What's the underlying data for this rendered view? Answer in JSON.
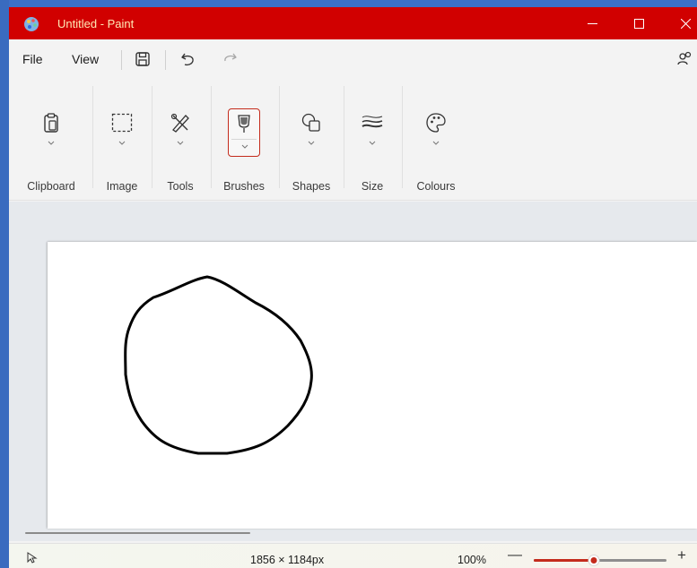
{
  "window": {
    "title": "Untitled - Paint",
    "accent_color": "#d10000"
  },
  "menubar": {
    "file_label": "File",
    "view_label": "View",
    "icons": [
      "save-icon",
      "undo-icon",
      "redo-icon",
      "account-icon"
    ]
  },
  "ribbon": {
    "groups": [
      {
        "label": "Clipboard",
        "icon": "clipboard-icon"
      },
      {
        "label": "Image",
        "icon": "selection-icon"
      },
      {
        "label": "Tools",
        "icon": "tools-icon"
      },
      {
        "label": "Brushes",
        "icon": "brush-icon",
        "selected": true
      },
      {
        "label": "Shapes",
        "icon": "shapes-icon"
      },
      {
        "label": "Size",
        "icon": "size-icon"
      },
      {
        "label": "Colours",
        "icon": "palette-icon"
      }
    ],
    "selected_color": "#c42b1c"
  },
  "canvas": {
    "drawing": "freehand-circle"
  },
  "statusbar": {
    "dimensions": "1856 × 1184px",
    "zoom": "100%",
    "zoom_minus": "—",
    "zoom_plus": "+",
    "zoom_level_fraction": 0.45
  }
}
